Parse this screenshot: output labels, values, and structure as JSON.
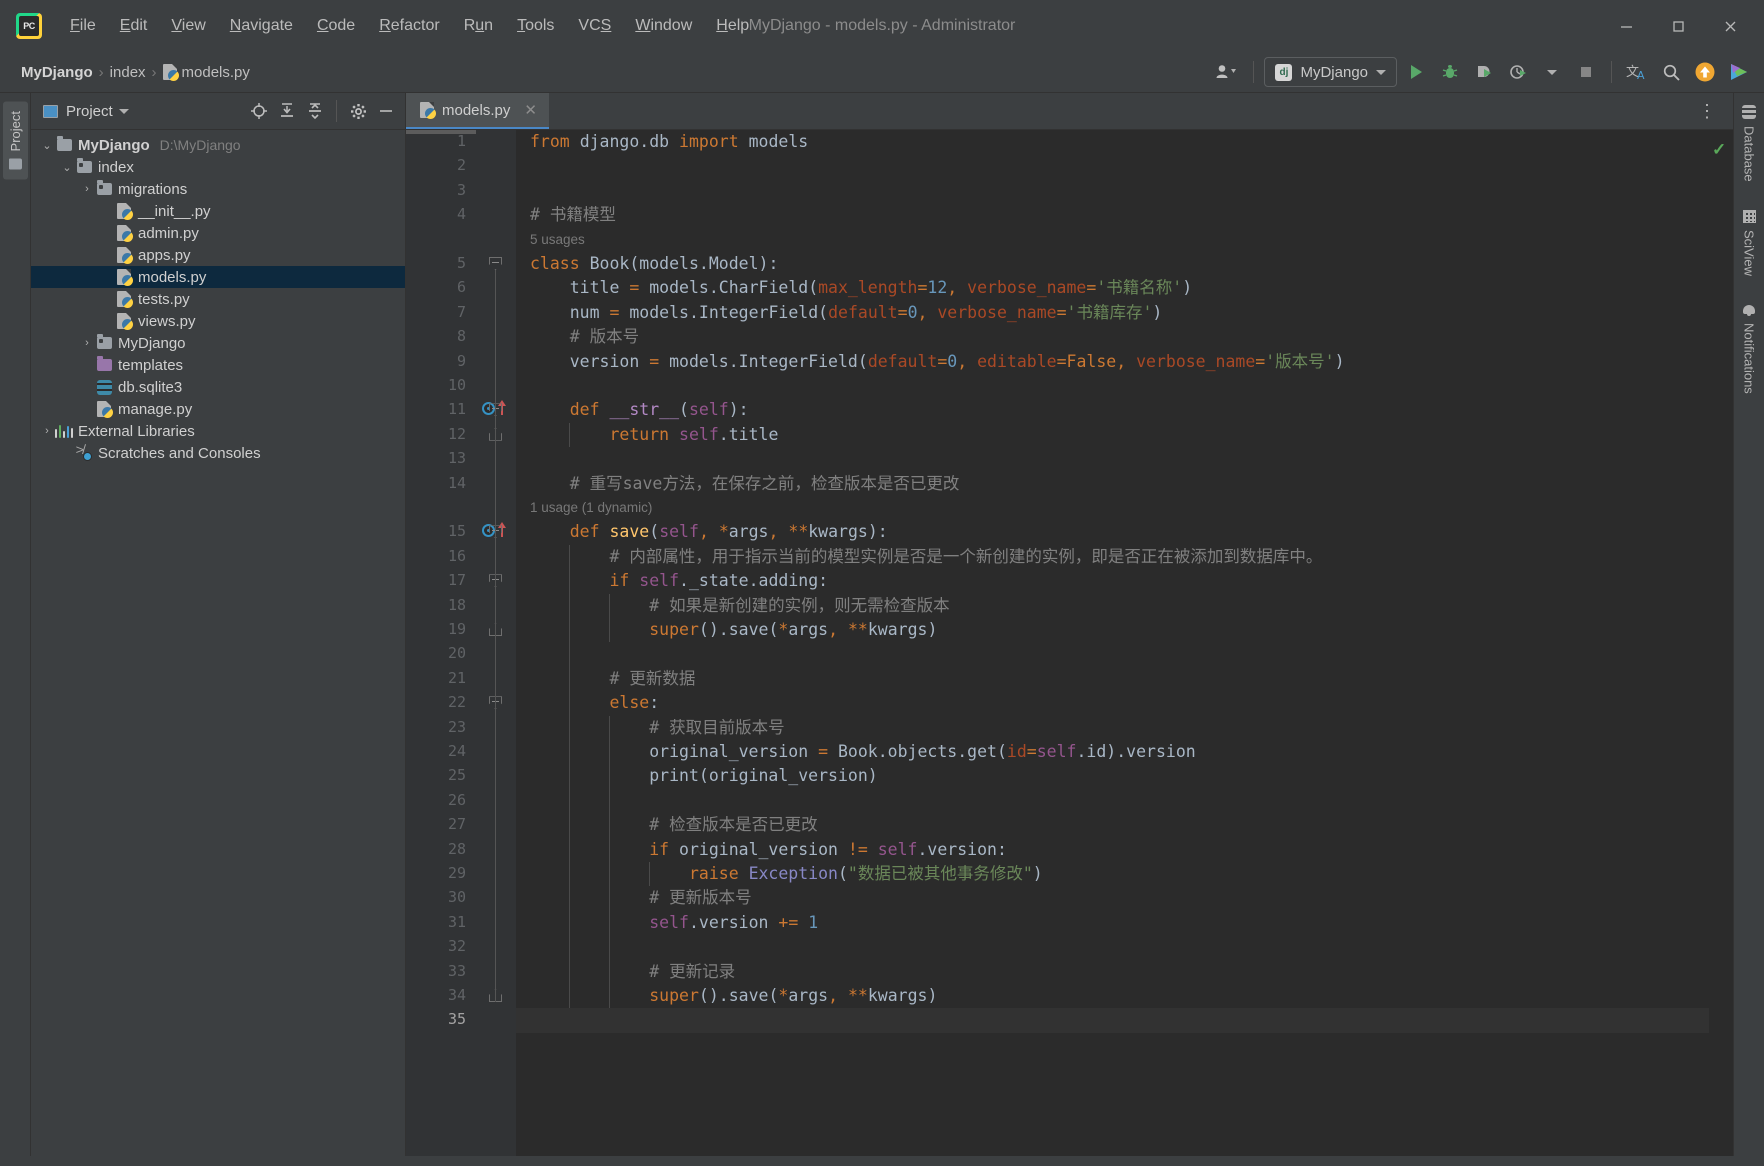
{
  "window": {
    "title": "MyDjango - models.py - Administrator",
    "minimize": "—",
    "maximize": "▢",
    "close": "✕"
  },
  "menubar": [
    {
      "label": "File"
    },
    {
      "label": "Edit"
    },
    {
      "label": "View"
    },
    {
      "label": "Navigate"
    },
    {
      "label": "Code"
    },
    {
      "label": "Refactor"
    },
    {
      "label": "Run"
    },
    {
      "label": "Tools"
    },
    {
      "label": "VCS"
    },
    {
      "label": "Window"
    },
    {
      "label": "Help"
    }
  ],
  "breadcrumb": {
    "project": "MyDjango",
    "sep": "›",
    "folder": "index",
    "file": "models.py"
  },
  "toolbar": {
    "run_config_name": "MyDjango",
    "dj_badge": "dj",
    "icons": {
      "profile": "user-accounts-icon",
      "run": "run-icon",
      "debug": "debug-icon",
      "coverage": "run-with-coverage-icon",
      "profiler": "profiler-icon",
      "stop": "stop-icon",
      "translate": "translate-icon",
      "search": "search-everywhere-icon",
      "update": "update-icon",
      "ide": "ide-feature-icon"
    }
  },
  "left_rail": {
    "project_tab": "Project"
  },
  "project_panel": {
    "title": "Project",
    "actions": [
      "locate-icon",
      "expand-all-icon",
      "collapse-all-icon",
      "settings-icon",
      "hide-icon"
    ],
    "tree": [
      {
        "label": "MyDjango",
        "path": "D:\\MyDjango",
        "icon": "folder",
        "indent": 0,
        "arrow": "down",
        "bold": true,
        "selected": false
      },
      {
        "label": "index",
        "path": "",
        "icon": "folder-src",
        "indent": 1,
        "arrow": "down",
        "bold": false,
        "selected": false
      },
      {
        "label": "migrations",
        "path": "",
        "icon": "folder-src",
        "indent": 2,
        "arrow": "right",
        "bold": false,
        "selected": false
      },
      {
        "label": "__init__.py",
        "path": "",
        "icon": "py",
        "indent": 3,
        "arrow": "",
        "bold": false,
        "selected": false
      },
      {
        "label": "admin.py",
        "path": "",
        "icon": "py",
        "indent": 3,
        "arrow": "",
        "bold": false,
        "selected": false
      },
      {
        "label": "apps.py",
        "path": "",
        "icon": "py",
        "indent": 3,
        "arrow": "",
        "bold": false,
        "selected": false
      },
      {
        "label": "models.py",
        "path": "",
        "icon": "py",
        "indent": 3,
        "arrow": "",
        "bold": false,
        "selected": true
      },
      {
        "label": "tests.py",
        "path": "",
        "icon": "py",
        "indent": 3,
        "arrow": "",
        "bold": false,
        "selected": false
      },
      {
        "label": "views.py",
        "path": "",
        "icon": "py",
        "indent": 3,
        "arrow": "",
        "bold": false,
        "selected": false
      },
      {
        "label": "MyDjango",
        "path": "",
        "icon": "folder-src",
        "indent": 2,
        "arrow": "right",
        "bold": false,
        "selected": false
      },
      {
        "label": "templates",
        "path": "",
        "icon": "folder-purple",
        "indent": 2,
        "arrow": "",
        "bold": false,
        "selected": false
      },
      {
        "label": "db.sqlite3",
        "path": "",
        "icon": "db",
        "indent": 2,
        "arrow": "",
        "bold": false,
        "selected": false
      },
      {
        "label": "manage.py",
        "path": "",
        "icon": "py",
        "indent": 2,
        "arrow": "",
        "bold": false,
        "selected": false
      },
      {
        "label": "External Libraries",
        "path": "",
        "icon": "lib",
        "indent": 0,
        "arrow": "right",
        "bold": false,
        "selected": false
      },
      {
        "label": "Scratches and Consoles",
        "path": "",
        "icon": "scratch",
        "indent": 1,
        "arrow": "",
        "bold": false,
        "selected": false
      }
    ]
  },
  "editor": {
    "tab": {
      "label": "models.py",
      "close": "✕",
      "icon": "python-file-icon"
    },
    "kebab": "⋮",
    "inspection_status": "✓",
    "current_line": 35,
    "total_lines": 35,
    "hints": [
      {
        "after_line": 4,
        "text": "5 usages"
      },
      {
        "after_line": 14,
        "text": "1 usage (1 dynamic)"
      }
    ],
    "lines": [
      {
        "n": 1,
        "text": "from django.db import models"
      },
      {
        "n": 2,
        "text": ""
      },
      {
        "n": 3,
        "text": ""
      },
      {
        "n": 4,
        "text": "# 书籍模型"
      },
      {
        "n": 5,
        "text": "class Book(models.Model):"
      },
      {
        "n": 6,
        "text": "    title = models.CharField(max_length=12, verbose_name='书籍名称')"
      },
      {
        "n": 7,
        "text": "    num = models.IntegerField(default=0, verbose_name='书籍库存')"
      },
      {
        "n": 8,
        "text": "    # 版本号"
      },
      {
        "n": 9,
        "text": "    version = models.IntegerField(default=0, editable=False, verbose_name='版本号')"
      },
      {
        "n": 10,
        "text": ""
      },
      {
        "n": 11,
        "text": "    def __str__(self):"
      },
      {
        "n": 12,
        "text": "        return self.title"
      },
      {
        "n": 13,
        "text": ""
      },
      {
        "n": 14,
        "text": "    # 重写save方法，在保存之前，检查版本是否已更改"
      },
      {
        "n": 15,
        "text": "    def save(self, *args, **kwargs):"
      },
      {
        "n": 16,
        "text": "        # 内部属性，用于指示当前的模型实例是否是一个新创建的实例，即是否正在被添加到数据库中。"
      },
      {
        "n": 17,
        "text": "        if self._state.adding:"
      },
      {
        "n": 18,
        "text": "            # 如果是新创建的实例，则无需检查版本"
      },
      {
        "n": 19,
        "text": "            super().save(*args, **kwargs)"
      },
      {
        "n": 20,
        "text": ""
      },
      {
        "n": 21,
        "text": "        # 更新数据"
      },
      {
        "n": 22,
        "text": "        else:"
      },
      {
        "n": 23,
        "text": "            # 获取目前版本号"
      },
      {
        "n": 24,
        "text": "            original_version = Book.objects.get(id=self.id).version"
      },
      {
        "n": 25,
        "text": "            print(original_version)"
      },
      {
        "n": 26,
        "text": ""
      },
      {
        "n": 27,
        "text": "            # 检查版本是否已更改"
      },
      {
        "n": 28,
        "text": "            if original_version != self.version:"
      },
      {
        "n": 29,
        "text": "                raise Exception(\"数据已被其他事务修改\")"
      },
      {
        "n": 30,
        "text": "            # 更新版本号"
      },
      {
        "n": 31,
        "text": "            self.version += 1"
      },
      {
        "n": 32,
        "text": ""
      },
      {
        "n": 33,
        "text": "            # 更新记录"
      },
      {
        "n": 34,
        "text": "            super().save(*args, **kwargs)"
      },
      {
        "n": 35,
        "text": ""
      }
    ]
  },
  "right_rail": [
    {
      "label": "Database",
      "icon": "database-icon"
    },
    {
      "label": "SciView",
      "icon": "sciview-icon"
    },
    {
      "label": "Notifications",
      "icon": "bell-icon"
    }
  ],
  "colors": {
    "accent_blue": "#4a88c7",
    "selection": "#0d293e",
    "editor_bg": "#2b2b2b",
    "panel_bg": "#3c3f41",
    "keyword": "#cc7832",
    "string": "#6a8759",
    "comment": "#808080",
    "number": "#6897bb",
    "function": "#ffc66d",
    "named_arg": "#aa4926",
    "self_kw": "#94558d",
    "success_green": "#5aa85a"
  }
}
